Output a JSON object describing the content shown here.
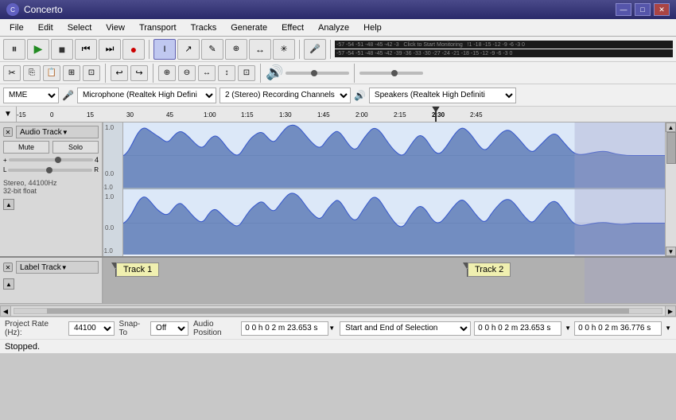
{
  "app": {
    "title": "Concerto",
    "icon": "C"
  },
  "window_controls": {
    "minimize": "—",
    "maximize": "□",
    "close": "✕"
  },
  "menu": {
    "items": [
      "File",
      "Edit",
      "Select",
      "View",
      "Transport",
      "Tracks",
      "Generate",
      "Effect",
      "Analyze",
      "Help"
    ]
  },
  "transport": {
    "pause": "⏸",
    "play": "▶",
    "stop": "■",
    "prev": "⏮",
    "next": "⏭",
    "record": "●"
  },
  "vu_scale": "-57 -54 -51 -48 -45 -42 -3  Click to Start Monitoring !1 -18 -15 -12 -9 -6 -3 0",
  "vu_scale2": "-57 -54 -51 -48 -45 -42 -39 -36 -33 -30 -27 -24 -21 -18 -15 -12 -9 -6 -3 0",
  "devices": {
    "driver": "MME",
    "microphone": "Microphone (Realtek High Defini",
    "channels": "2 (Stereo) Recording Channels",
    "speaker": "Speakers (Realtek High Definiti"
  },
  "ruler": {
    "marks": [
      "-15",
      "0",
      "15",
      "30",
      "45",
      "1:00",
      "1:15",
      "1:30",
      "1:45",
      "2:00",
      "2:15",
      "2:30",
      "2:45"
    ],
    "playhead": "2:30"
  },
  "audio_track": {
    "name": "Audio Track",
    "mute": "Mute",
    "solo": "Solo",
    "info": "Stereo, 44100Hz\n32-bit float",
    "gain_label": "4",
    "pan_l": "L",
    "pan_r": "R"
  },
  "label_track": {
    "name": "Label Track",
    "track1": "Track 1",
    "track2": "Track 2"
  },
  "status_bar": {
    "project_rate_label": "Project Rate (Hz):",
    "project_rate": "44100",
    "snap_to_label": "Snap-To",
    "snap_to": "Off",
    "audio_position_label": "Audio Position",
    "position1": "0 0 h 0 2 m 23.653 s",
    "position2": "0 0 h 0 2 m 23.653 s",
    "position3": "0 0 h 0 2 m 36.776 s",
    "selection_label": "Start and End of Selection",
    "stopped": "Stopped."
  },
  "toolbar2_buttons": {
    "cut": "✂",
    "copy": "⎘",
    "paste": "📋",
    "trim": "⊞",
    "silence": "⊡",
    "undo": "↩",
    "redo": "↪",
    "zoom_in": "🔍+",
    "zoom_out": "🔍-",
    "fit_h": "↔",
    "fit_v": "↕",
    "zoom_sel": "⊡"
  }
}
